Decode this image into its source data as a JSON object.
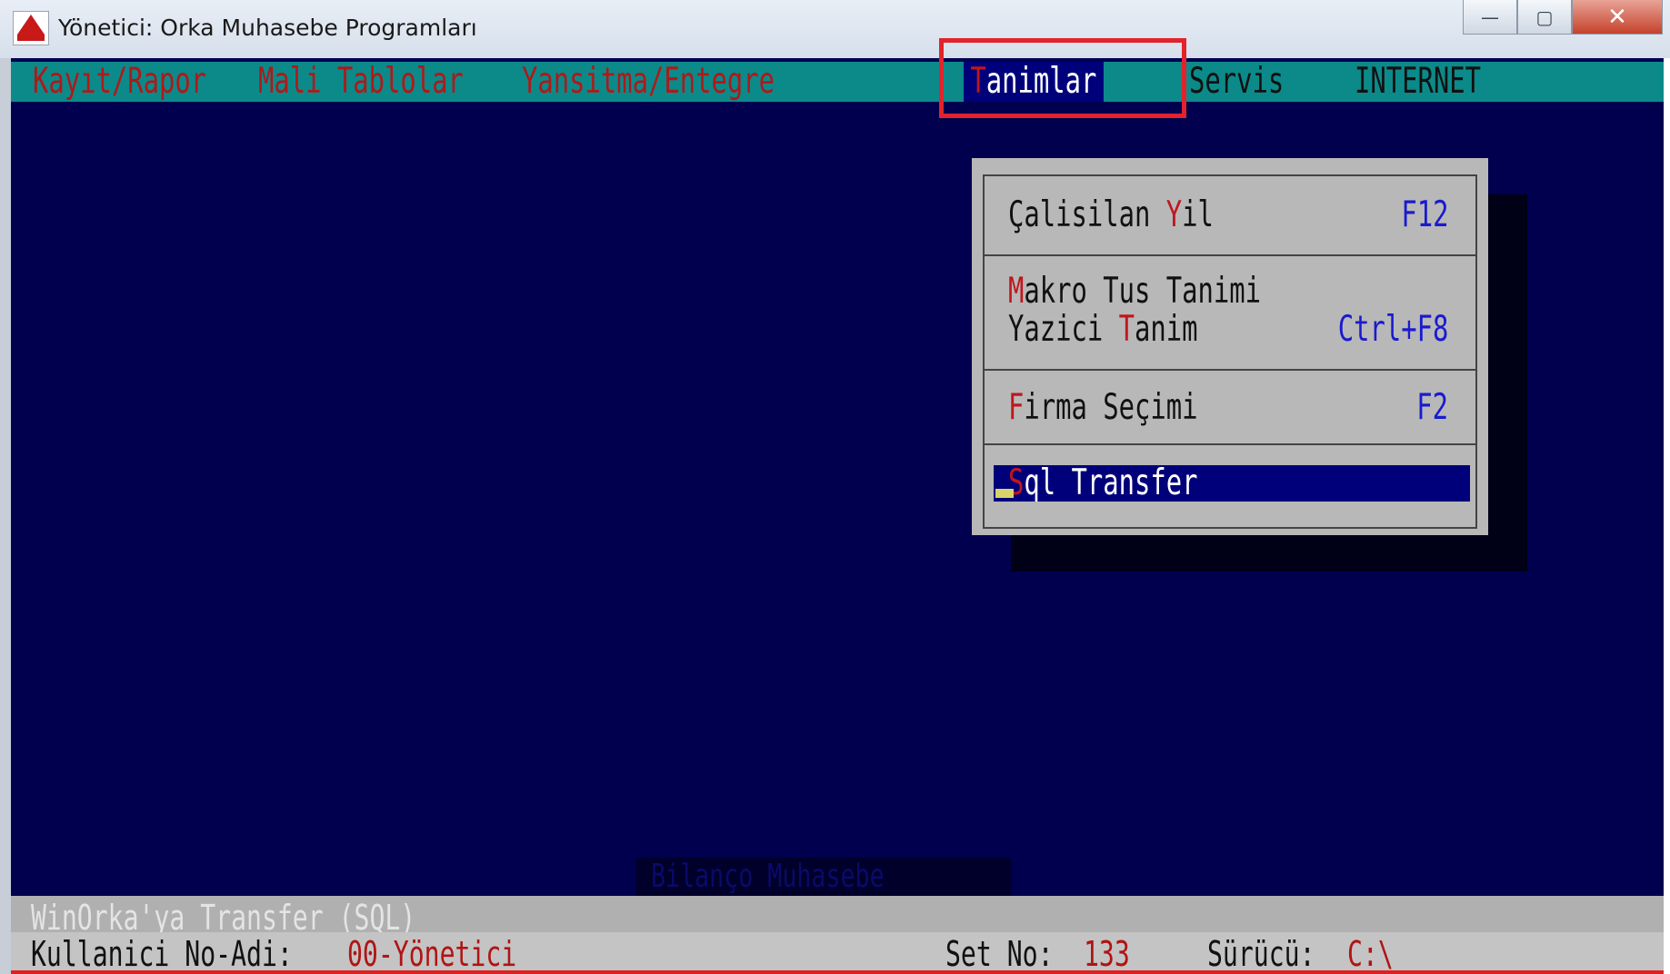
{
  "window": {
    "title": "Yönetici:  Orka Muhasebe Programları",
    "buttons": {
      "minimize": "—",
      "maximize": "▢",
      "close": "✕"
    }
  },
  "menubar": {
    "items": [
      {
        "label": "Kayıt/Rapor"
      },
      {
        "label": "Mali Tablolar"
      },
      {
        "label": "Yansitma/Entegre"
      },
      {
        "label": "Tanimlar",
        "active": true
      },
      {
        "label": "Servis"
      },
      {
        "label": "INTERNET"
      }
    ]
  },
  "dropdown": {
    "items": [
      {
        "hot": "Ç",
        "rest": "alisilan ",
        "hot2": "Y",
        "rest2": "il",
        "shortcut": "F12"
      },
      {
        "hot": "M",
        "rest": "akro Tus Tanimi",
        "shortcut": ""
      },
      {
        "pre": "Yazici ",
        "hot": "T",
        "rest": "anim",
        "shortcut": "Ctrl+F8"
      },
      {
        "hot": "F",
        "rest": "irma Seçimi",
        "shortcut": "F2"
      },
      {
        "hot": "S",
        "rest": "ql Transfer",
        "shortcut": "",
        "selected": true
      }
    ]
  },
  "background_label": "Bilanço Muhasebe",
  "status": {
    "message": "WinOrka'ya Transfer (SQL)",
    "user_label": "Kullanici No-Adi: ",
    "user_value": "00-Yönetici",
    "set_label": "Set No: ",
    "set_value": "133",
    "drive_label": "Sürücü: ",
    "drive_value": "C:\\"
  },
  "colors": {
    "console_bg": "#00004f",
    "menubar_bg": "#0c8a8a",
    "hotkey_red": "#c0161e",
    "shortcut_blue": "#1a1ad0",
    "selection_bg": "#00007a",
    "highlight_box": "#e2232b"
  }
}
